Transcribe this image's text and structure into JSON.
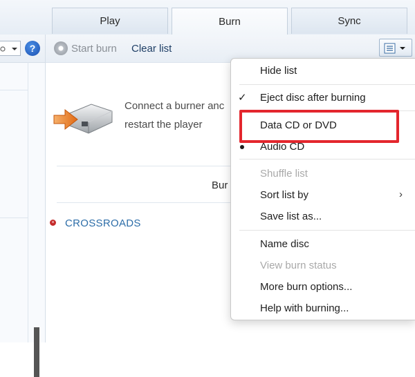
{
  "tabs": [
    {
      "label": "Play"
    },
    {
      "label": "Burn"
    },
    {
      "label": "Sync"
    }
  ],
  "left": {
    "help_glyph": "?"
  },
  "toolbar": {
    "start_burn": "Start burn",
    "clear_list": "Clear list"
  },
  "burn": {
    "message_line1": "Connect a burner anc",
    "message_line2": "restart the player",
    "burn_list_label": "Bur",
    "track": "CROSSROADS"
  },
  "menu": {
    "hide_list": "Hide list",
    "eject_disc": "Eject disc after burning",
    "data_cd": "Data CD or DVD",
    "audio_cd": "Audio CD",
    "shuffle_list": "Shuffle list",
    "sort_list_by": "Sort list by",
    "save_list_as": "Save list as...",
    "name_disc": "Name disc",
    "view_burn_status": "View burn status",
    "more_burn_options": "More burn options...",
    "help_with_burning": "Help with burning..."
  },
  "colors": {
    "highlight": "#e3262d",
    "link": "#2c6da8",
    "disabled": "#a9a9a9"
  }
}
